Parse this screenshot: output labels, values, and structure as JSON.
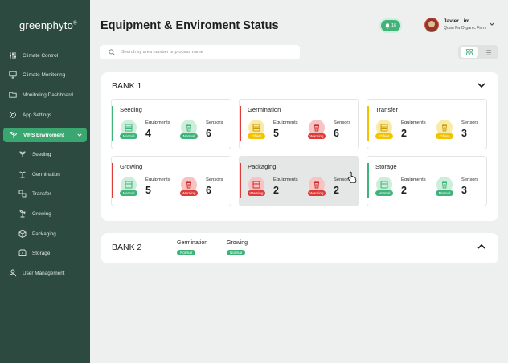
{
  "brand": {
    "logo_text": "greenphyto",
    "logo_mark": "®"
  },
  "sidebar": {
    "items": [
      {
        "label": "Climate Control",
        "icon": "sliders-icon"
      },
      {
        "label": "Climate Monitoring",
        "icon": "monitor-icon"
      },
      {
        "label": "Monitoring Dashboard",
        "icon": "folder-icon"
      },
      {
        "label": "App Settings",
        "icon": "gear-icon"
      },
      {
        "label": "VIFS Enviroment",
        "icon": "sprout-icon",
        "active": true
      },
      {
        "label": "Seeding",
        "icon": "seed-icon",
        "sub": true
      },
      {
        "label": "Germination",
        "icon": "germination-icon",
        "sub": true
      },
      {
        "label": "Transfer",
        "icon": "transfer-icon",
        "sub": true
      },
      {
        "label": "Growing",
        "icon": "growing-icon",
        "sub": true
      },
      {
        "label": "Packaging",
        "icon": "box-icon",
        "sub": true
      },
      {
        "label": "Storage",
        "icon": "storage-icon",
        "sub": true
      },
      {
        "label": "User Management",
        "icon": "user-icon"
      }
    ]
  },
  "header": {
    "title": "Equipment & Enviroment Status",
    "notifications": {
      "count": "16",
      "icon": "bell-icon"
    },
    "user": {
      "name": "Javier Lim",
      "farm": "Quan Fa Organic Farm"
    }
  },
  "search": {
    "placeholder": "Search by area number or process name",
    "value": ""
  },
  "view": {
    "active": "grid"
  },
  "colors": {
    "normal": "#3fb37a",
    "offset": "#f2c300",
    "warning": "#dd3a3a",
    "accent": "#3aa670",
    "sidebar": "#2c4a40"
  },
  "bank1": {
    "title": "BANK 1",
    "expanded": true,
    "cards": [
      {
        "title": "Seeding",
        "status": "normal",
        "equipments": {
          "label": "Equipments",
          "value": "4",
          "status": "normal",
          "badge": "Normal"
        },
        "sensors": {
          "label": "Sensors",
          "value": "6",
          "status": "normal",
          "badge": "Normal"
        }
      },
      {
        "title": "Germination",
        "status": "warning",
        "equipments": {
          "label": "Equipments",
          "value": "5",
          "status": "offset",
          "badge": "Offset"
        },
        "sensors": {
          "label": "Sensors",
          "value": "6",
          "status": "warning",
          "badge": "Warning"
        }
      },
      {
        "title": "Transfer",
        "status": "offset",
        "equipments": {
          "label": "Equipments",
          "value": "2",
          "status": "offset",
          "badge": "Offset"
        },
        "sensors": {
          "label": "Sensors",
          "value": "3",
          "status": "offset",
          "badge": "Offset"
        }
      },
      {
        "title": "Growing",
        "status": "warning",
        "equipments": {
          "label": "Equipments",
          "value": "5",
          "status": "normal",
          "badge": "Normal"
        },
        "sensors": {
          "label": "Sensors",
          "value": "6",
          "status": "warning",
          "badge": "Warning"
        }
      },
      {
        "title": "Packaging",
        "status": "warning",
        "hover": true,
        "equipments": {
          "label": "Equipments",
          "value": "2",
          "status": "warning",
          "badge": "Warning"
        },
        "sensors": {
          "label": "Sensors",
          "value": "2",
          "status": "warning",
          "badge": "Warning"
        }
      },
      {
        "title": "Storage",
        "status": "normal",
        "equipments": {
          "label": "Equipments",
          "value": "2",
          "status": "normal",
          "badge": "Normal"
        },
        "sensors": {
          "label": "Sensors",
          "value": "3",
          "status": "normal",
          "badge": "Normal"
        }
      }
    ]
  },
  "bank2": {
    "title": "BANK 2",
    "expanded": false,
    "items": [
      {
        "label": "Germination",
        "badge": "Normal"
      },
      {
        "label": "Growing",
        "badge": "Normal"
      }
    ]
  }
}
